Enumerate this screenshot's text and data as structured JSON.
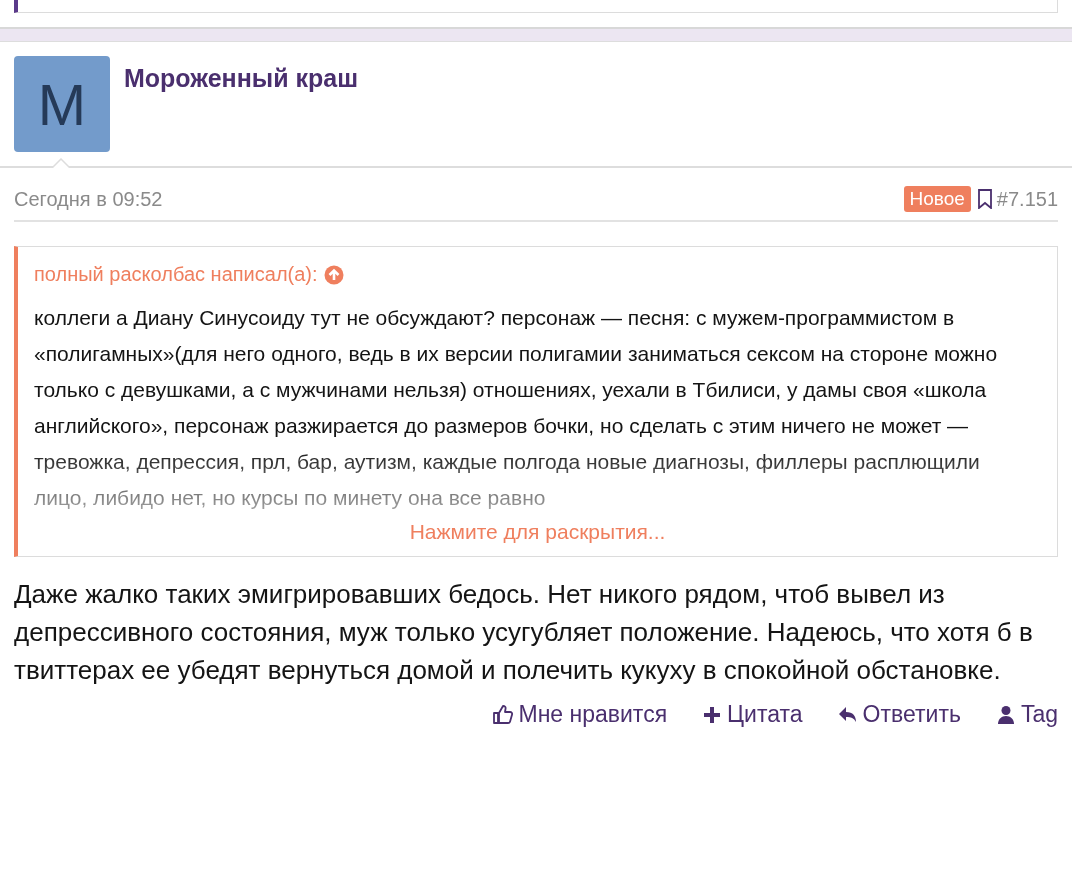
{
  "post": {
    "avatar_letter": "M",
    "author": "Мороженный краш",
    "time": "Сегодня в 09:52",
    "badge": "Новое",
    "post_number": "#7.151",
    "quote": {
      "attribution": "полный расколбас написал(а):",
      "text": "коллеги а Диану Синусоиду тут не обсуждают? персонаж — песня: с мужем-программистом в «полигамных»(для него одного, ведь в их версии полигамии заниматься сексом на стороне можно только с девушками, а с мужчинами нельзя) отношениях, уехали в Тбилиси, у дамы своя «школа английского», персонаж разжирается до размеров бочки, но сделать с этим ничего не может — тревожка, депрессия, прл, бар, аутизм, каждые полгода новые диагнозы, филлеры расплющили лицо, либидо нет, но курсы по минету она все равно",
      "expand_link": "Нажмите для раскрытия..."
    },
    "message": "Даже жалко таких эмигрировавших бедось. Нет никого рядом, чтоб вывел из депрессивного состояния, муж только усугубляет положение. Надеюсь, что хотя б в твиттерах ее убедят вернуться домой и полечить кукуху в спокойной обстановке.",
    "actions": [
      {
        "label": "Мне нравится",
        "kind": "like"
      },
      {
        "label": "Цитата",
        "kind": "quote"
      },
      {
        "label": "Ответить",
        "kind": "reply"
      },
      {
        "label": "Tag",
        "kind": "tag"
      }
    ]
  }
}
